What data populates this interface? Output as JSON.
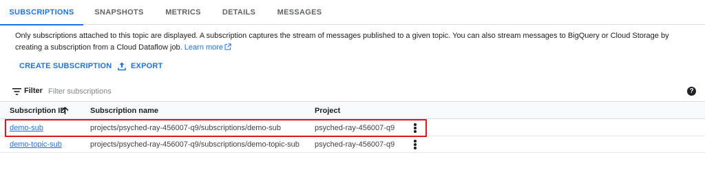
{
  "tabs": [
    {
      "label": "SUBSCRIPTIONS",
      "active": true
    },
    {
      "label": "SNAPSHOTS",
      "active": false
    },
    {
      "label": "METRICS",
      "active": false
    },
    {
      "label": "DETAILS",
      "active": false
    },
    {
      "label": "MESSAGES",
      "active": false
    }
  ],
  "description": {
    "text": "Only subscriptions attached to this topic are displayed. A subscription captures the stream of messages published to a given topic. You can also stream messages to BigQuery or Cloud Storage by creating a subscription from a Cloud Dataflow job.",
    "link_label": "Learn more",
    "link_icon": "open-in-new-icon"
  },
  "actions": {
    "create_label": "CREATE SUBSCRIPTION",
    "export_label": "EXPORT",
    "export_icon": "export-upload-icon"
  },
  "filter": {
    "label": "Filter",
    "placeholder": "Filter subscriptions",
    "icon": "filter-list-icon",
    "help_icon": "help-icon",
    "help_glyph": "?"
  },
  "table": {
    "columns": {
      "id": "Subscription ID",
      "name": "Subscription name",
      "project": "Project"
    },
    "sort": {
      "column": "id",
      "direction": "ascending",
      "icon": "arrow-up-icon"
    },
    "rows": [
      {
        "id": "demo-sub",
        "name": "projects/psyched-ray-456007-q9/subscriptions/demo-sub",
        "project": "psyched-ray-456007-q9",
        "highlighted": true
      },
      {
        "id": "demo-topic-sub",
        "name": "projects/psyched-ray-456007-q9/subscriptions/demo-topic-sub",
        "project": "psyched-ray-456007-q9",
        "highlighted": false
      }
    ]
  },
  "colors": {
    "accent": "#1a73e8",
    "highlight_border": "#e0141e",
    "header_bg": "#f8f9fa",
    "divider": "#dadce0"
  }
}
